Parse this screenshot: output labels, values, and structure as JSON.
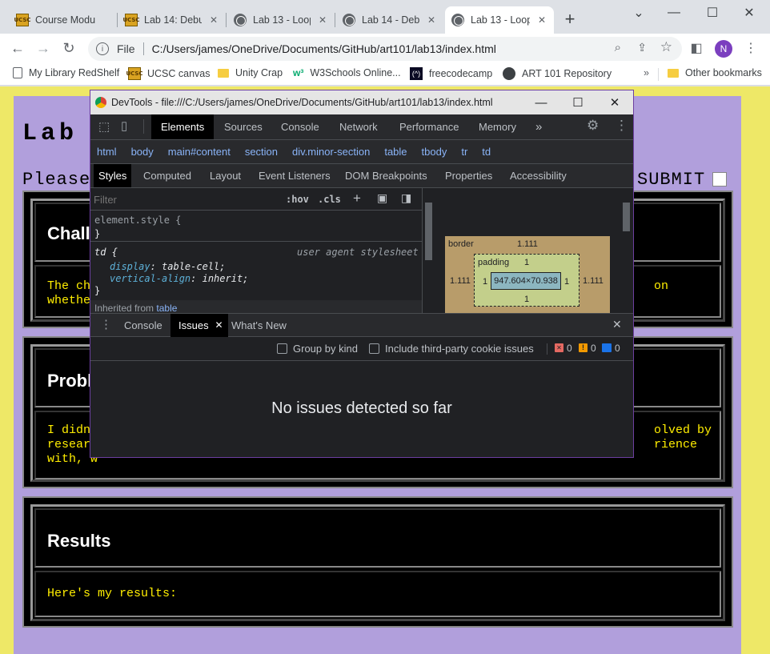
{
  "tabs": [
    {
      "label": "Course Modu",
      "icon": "ucsc-icon"
    },
    {
      "label": "Lab 14: Debu",
      "icon": "ucsc-icon"
    },
    {
      "label": "Lab 13 - Loop",
      "icon": "globe-icon"
    },
    {
      "label": "Lab 14 - Debu",
      "icon": "globe-icon"
    },
    {
      "label": "Lab 13 - Loop",
      "icon": "globe-icon"
    }
  ],
  "window_controls": {
    "chevron": "⌄",
    "minimize": "—",
    "maximize": "☐",
    "close": "✕"
  },
  "toolbar": {
    "file_label": "File",
    "url": "C:/Users/james/OneDrive/Documents/GitHub/art101/lab13/index.html",
    "profile": "N"
  },
  "bookmarks": [
    "My Library RedShelf",
    "UCSC canvas",
    "Unity Crap",
    "W3Schools Online...",
    "freecodecamp",
    "ART 101 Repository",
    "Other bookmarks"
  ],
  "page": {
    "title": "Lab",
    "prompt": "Please",
    "submit": "SUBMIT",
    "sections": [
      {
        "heading": "Challer",
        "text1": "The cha",
        "text1b": "on",
        "text2": "whether"
      },
      {
        "heading": "Proble",
        "text1": "I didn'",
        "text1b": "olved by",
        "text2": "researc",
        "text2b": "rience",
        "text3": "with, w"
      },
      {
        "heading": "Results",
        "text1": "Here's my results:"
      }
    ]
  },
  "devtools": {
    "title": "DevTools - file:///C:/Users/james/OneDrive/Documents/GitHub/art101/lab13/index.html",
    "tabs": [
      "Elements",
      "Sources",
      "Console",
      "Network",
      "Performance",
      "Memory"
    ],
    "more": "»",
    "breadcrumbs": [
      "html",
      "body",
      "main#content",
      "section",
      "div.minor-section",
      "table",
      "tbody",
      "tr",
      "td"
    ],
    "style_tabs": [
      "Styles",
      "Computed",
      "Layout",
      "Event Listeners",
      "DOM Breakpoints",
      "Properties",
      "Accessibility"
    ],
    "filter_placeholder": "Filter",
    "hov": ":hov",
    "cls": ".cls",
    "css": {
      "element_style": "element.style {",
      "close": "}",
      "td_selector": "td {",
      "ua": "user agent stylesheet",
      "prop1": "display",
      "val1": "table-cell;",
      "prop2": "vertical-align",
      "val2": "inherit;",
      "inherited": "Inherited from",
      "inherited_link": "table"
    },
    "boxmodel": {
      "border_label": "border",
      "border_val": "1.111",
      "padding_label": "padding",
      "padding_val": "1",
      "content": "947.604×70.938",
      "left_border": "1.111",
      "right_border": "1.111",
      "left_pad": "1",
      "right_pad": "1",
      "bottom_pad": "1"
    },
    "drawer_tabs": [
      "Console",
      "Issues",
      "What's New"
    ],
    "issues": {
      "group": "Group by kind",
      "third_party": "Include third-party cookie issues",
      "err_count": "0",
      "warn_count": "0",
      "info_count": "0",
      "empty": "No issues detected so far"
    },
    "colors": {
      "err": "#e46962",
      "warn": "#f29900",
      "info": "#1a73e8"
    }
  }
}
